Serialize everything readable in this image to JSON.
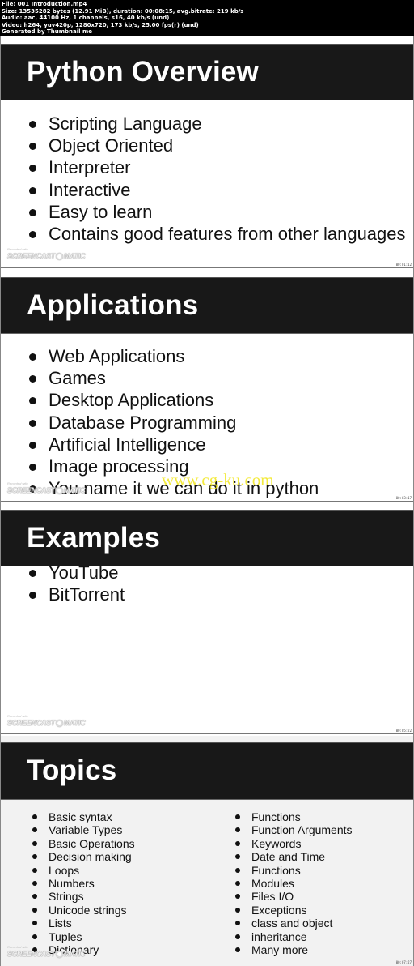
{
  "file_info": {
    "lines": [
      "File: 001 Introduction.mp4",
      "Size: 13535282 bytes (12.91 MiB), duration: 00:08:15, avg.bitrate: 219 kb/s",
      "Audio: aac, 44100 Hz, 1 channels, s16, 40 kb/s (und)",
      "Video: h264, yuv420p, 1280x720, 173 kb/s, 25.00 fps(r) (und)",
      "Generated by Thumbnail me"
    ]
  },
  "watermark": {
    "recorded_with": "Recorded with",
    "brand_left": "SCREENCAST",
    "brand_right": "MATIC",
    "site": "www.cg-ku.com"
  },
  "frames": [
    {
      "title": "Python Overview",
      "timestamp": "00:01:12",
      "bullets": [
        "Scripting Language",
        "Object Oriented",
        "Interpreter",
        "Interactive",
        "Easy to learn",
        "Contains good features from other languages"
      ]
    },
    {
      "title": "Applications",
      "timestamp": "00:03:17",
      "bullets": [
        "Web Applications",
        "Games",
        "Desktop Applications",
        "Database Programming",
        "Artificial Intelligence",
        "Image processing",
        "You name it we can do it in python"
      ]
    },
    {
      "title": "Examples",
      "timestamp": "00:05:22",
      "bullets": [
        "YouTube",
        "BitTorrent"
      ]
    },
    {
      "title": "Topics",
      "timestamp": "00:07:27",
      "left_column": [
        "Basic syntax",
        "Variable Types",
        "Basic Operations",
        "Decision making",
        "Loops",
        "Numbers",
        "Strings",
        "Unicode strings",
        "Lists",
        "Tuples",
        "Dictionary"
      ],
      "right_column": [
        "Functions",
        "Function Arguments",
        "Keywords",
        "Date and Time",
        "Functions",
        "Modules",
        "Files I/O",
        "Exceptions",
        "class and object",
        "inheritance",
        "Many more"
      ]
    }
  ],
  "colors": {
    "title_bar": "#181818",
    "slide_bg": "#ffffff",
    "topics_bg": "#f2f2f2",
    "site_watermark": "#f2e71c"
  }
}
